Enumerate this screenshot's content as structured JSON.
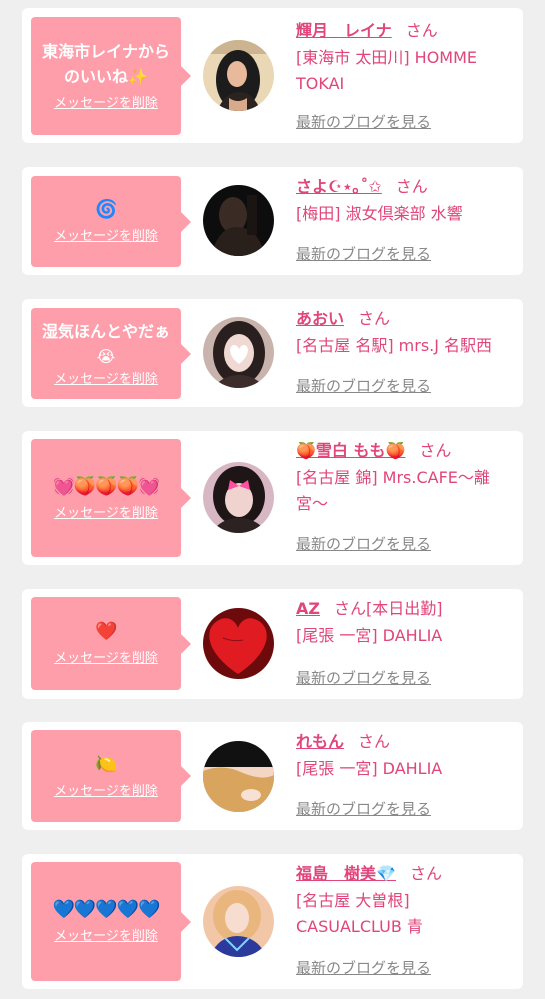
{
  "delete_label": "メッセージを削除",
  "blog_label": "最新のブログを見る",
  "san_label": "さん",
  "colors": {
    "background": "#efefef",
    "card": "#ffffff",
    "bubble": "#ff9eab",
    "accent": "#e0457b",
    "link_gray": "#888888"
  },
  "items": [
    {
      "message": "東海市レイナから\nのいいね✨",
      "name": "輝月　レイナ",
      "san": "さん",
      "shop": "[東海市 太田川] HOMME TOKAI",
      "avatar_icon": "avatar-woman-dark-hair-icon",
      "avatar_colors": [
        "#e9d7b6",
        "#1c1c1c"
      ]
    },
    {
      "message": "🌀",
      "name": "さよ☪︎⋆｡˚✩",
      "san": "さん",
      "shop": "[梅田] 淑女倶楽部 水響",
      "avatar_icon": "avatar-silhouette-dark-icon",
      "avatar_colors": [
        "#3a2c25",
        "#0d0d0d"
      ]
    },
    {
      "message": "湿気ほんとやだぁ\n😭",
      "name": "あおい",
      "san": "さん",
      "shop": "[名古屋 名駅] mrs.J 名駅西",
      "avatar_icon": "avatar-woman-heart-face-icon",
      "avatar_colors": [
        "#c9b3ad",
        "#2a1f1f"
      ]
    },
    {
      "message": "💓🍑🍑🍑💓",
      "name": "🍑雪白 もも🍑",
      "san": "さん",
      "shop": "[名古屋 錦] Mrs.CAFE〜離宮〜",
      "avatar_icon": "avatar-woman-pink-butterfly-icon",
      "avatar_colors": [
        "#d8b7c4",
        "#1e1616"
      ]
    },
    {
      "message": "❤️",
      "name": "AZ",
      "san": "さん[本日出勤]",
      "shop": "[尾張 一宮] DAHLIA",
      "avatar_icon": "avatar-red-heart-icon",
      "avatar_colors": [
        "#e11b22",
        "#6d0a0c"
      ]
    },
    {
      "message": "🍋",
      "name": "れもん",
      "san": "さん",
      "shop": "[尾張 一宮] DAHLIA",
      "avatar_icon": "avatar-woman-blonde-icon",
      "avatar_colors": [
        "#111111",
        "#d9a45e"
      ]
    },
    {
      "message": "💙💙💙💙💙",
      "name": "福島　樹美💎",
      "san": "さん",
      "shop": "[名古屋 大曽根] CASUALCLUB 青",
      "avatar_icon": "avatar-woman-blue-dress-icon",
      "avatar_colors": [
        "#f2c7a8",
        "#2b3a9b"
      ]
    }
  ]
}
